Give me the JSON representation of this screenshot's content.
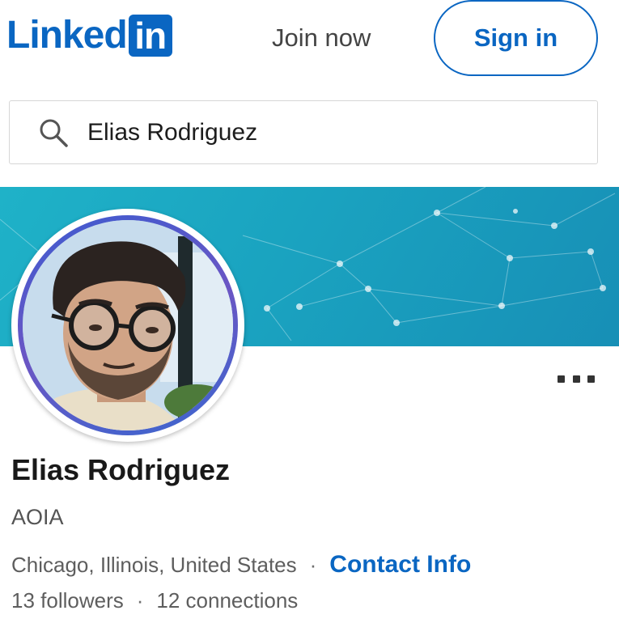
{
  "brand": {
    "logo_text": "Linked",
    "logo_box_text": "in",
    "color": "#0a66c2"
  },
  "header": {
    "join_label": "Join now",
    "signin_label": "Sign in"
  },
  "search": {
    "value": "Elias Rodriguez",
    "icon": "search-icon"
  },
  "profile": {
    "name": "Elias Rodriguez",
    "headline": "AOIA",
    "location": "Chicago, Illinois, United States",
    "separator": "·",
    "contact_label": "Contact Info",
    "followers": "13 followers",
    "connections": "12 connections",
    "more_icon": "more-options-icon",
    "banner_color": "#1aa3c0"
  }
}
